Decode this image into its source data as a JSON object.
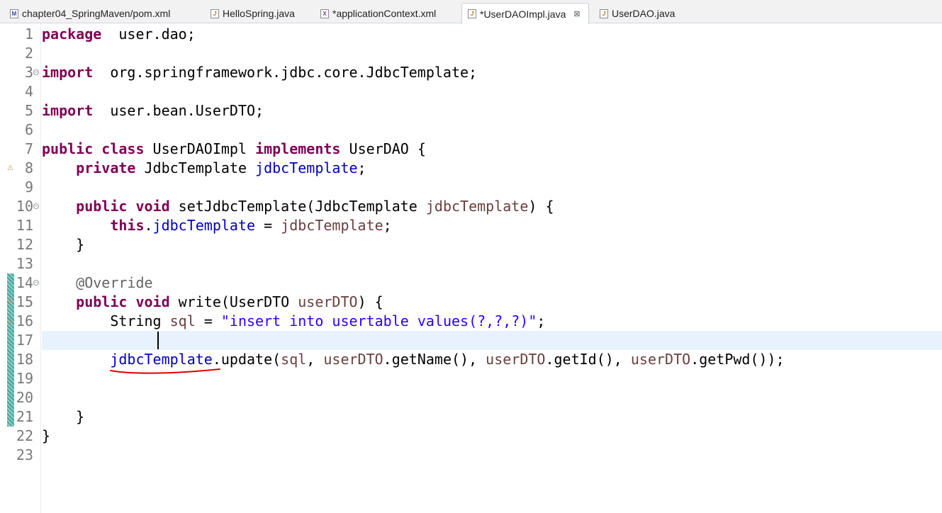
{
  "tabs": [
    {
      "label": "chapter04_SpringMaven/pom.xml",
      "icon": "maven-file-icon",
      "icon_letter": "M",
      "type": "m"
    },
    {
      "label": "HelloSpring.java",
      "icon": "java-file-icon",
      "icon_letter": "J",
      "type": "j"
    },
    {
      "label": "*applicationContext.xml",
      "icon": "xml-file-icon",
      "icon_letter": "X",
      "type": "x"
    },
    {
      "label": "*UserDAOImpl.java",
      "icon": "java-file-icon",
      "icon_letter": "J",
      "type": "j",
      "active": true,
      "close": "⊠"
    },
    {
      "label": "UserDAO.java",
      "icon": "java-file-icon",
      "icon_letter": "J",
      "type": "j"
    }
  ],
  "editor": {
    "line_numbers": [
      "1",
      "2",
      "3",
      "4",
      "5",
      "6",
      "7",
      "8",
      "9",
      "10",
      "11",
      "12",
      "13",
      "14",
      "15",
      "16",
      "17",
      "18",
      "19",
      "20",
      "21",
      "22",
      "23"
    ],
    "folds": [
      "3",
      "10",
      "14"
    ],
    "changed_lines": [
      "14",
      "15",
      "16",
      "17",
      "18",
      "19",
      "20",
      "21"
    ],
    "warning_lines": [
      "8",
      "15",
      "16"
    ],
    "current_line": "17",
    "lines": [
      [
        [
          "kw",
          "package"
        ],
        [
          "",
          "  user.dao;"
        ]
      ],
      [],
      [
        [
          "kw",
          "import"
        ],
        [
          "",
          "  org.springframework.jdbc.core.JdbcTemplate;"
        ]
      ],
      [],
      [
        [
          "kw",
          "import"
        ],
        [
          "",
          "  user.bean.UserDTO;"
        ]
      ],
      [],
      [
        [
          "kw",
          "public"
        ],
        [
          "",
          " "
        ],
        [
          "kw",
          "class"
        ],
        [
          "",
          " UserDAOImpl "
        ],
        [
          "kw",
          "implements"
        ],
        [
          "",
          " UserDAO {"
        ]
      ],
      [
        [
          "",
          "    "
        ],
        [
          "kw",
          "private"
        ],
        [
          "",
          " JdbcTemplate "
        ],
        [
          "fld",
          "jdbcTemplate"
        ],
        [
          "",
          ";"
        ]
      ],
      [],
      [
        [
          "",
          "    "
        ],
        [
          "kw",
          "public"
        ],
        [
          "",
          " "
        ],
        [
          "kw",
          "void"
        ],
        [
          "",
          " setJdbcTemplate(JdbcTemplate "
        ],
        [
          "var",
          "jdbcTemplate"
        ],
        [
          "",
          ") {"
        ]
      ],
      [
        [
          "",
          "        "
        ],
        [
          "kw",
          "this"
        ],
        [
          "",
          "."
        ],
        [
          "fld",
          "jdbcTemplate"
        ],
        [
          "",
          " = "
        ],
        [
          "var",
          "jdbcTemplate"
        ],
        [
          "",
          ";"
        ]
      ],
      [
        [
          "",
          "    }"
        ]
      ],
      [],
      [
        [
          "",
          "    "
        ],
        [
          "ann",
          "@Override"
        ]
      ],
      [
        [
          "",
          "    "
        ],
        [
          "kw",
          "public"
        ],
        [
          "",
          " "
        ],
        [
          "kw",
          "void"
        ],
        [
          "",
          " write(UserDTO "
        ],
        [
          "var",
          "userDTO"
        ],
        [
          "",
          ") {"
        ]
      ],
      [
        [
          "",
          "        String "
        ],
        [
          "var",
          "sql"
        ],
        [
          "",
          " = "
        ],
        [
          "str",
          "\"insert into usertable values(?,?,?)\""
        ],
        [
          "",
          ";"
        ]
      ],
      [],
      [
        [
          "",
          "        "
        ],
        [
          "fld",
          "jdbcTemplate"
        ],
        [
          "",
          ".update("
        ],
        [
          "var",
          "sql"
        ],
        [
          "",
          ", "
        ],
        [
          "var",
          "userDTO"
        ],
        [
          "",
          ".getName(), "
        ],
        [
          "var",
          "userDTO"
        ],
        [
          "",
          ".getId(), "
        ],
        [
          "var",
          "userDTO"
        ],
        [
          "",
          ".getPwd());"
        ]
      ],
      [],
      [],
      [
        [
          "",
          "    }"
        ]
      ],
      [
        [
          "",
          "}"
        ]
      ],
      []
    ]
  },
  "annotation": {
    "color": "#e00000",
    "target": "jdbcTemplate"
  }
}
